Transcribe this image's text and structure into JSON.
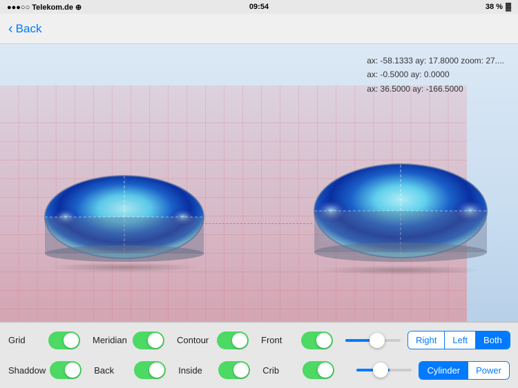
{
  "statusBar": {
    "carrier": "●●●○○ Telekom.de ⊕",
    "time": "09:54",
    "battery": "38 %"
  },
  "navBar": {
    "backLabel": "Back"
  },
  "viewport": {
    "info": [
      "ax: -58.1333  ay: 17.8000  zoom: 27....",
      "ax: -0.5000  ay: 0.0000",
      "ax: 36.5000  ay: -166.5000"
    ]
  },
  "controls": {
    "row1": [
      {
        "label": "Grid",
        "toggled": true
      },
      {
        "label": "Meridian",
        "toggled": true
      },
      {
        "label": "Contour",
        "toggled": true
      },
      {
        "label": "Front",
        "toggled": true
      }
    ],
    "row2": [
      {
        "label": "Shaddow",
        "toggled": true
      },
      {
        "label": "Back",
        "toggled": true
      },
      {
        "label": "Inside",
        "toggled": true
      },
      {
        "label": "Crib",
        "toggled": true
      }
    ],
    "lensSelector": {
      "buttons": [
        "Right",
        "Left",
        "Both"
      ],
      "active": "Both"
    },
    "displaySelector": {
      "buttons": [
        "Cylinder",
        "Power"
      ],
      "active": "Cylinder"
    },
    "slider1Value": 60,
    "slider2Value": 40
  }
}
